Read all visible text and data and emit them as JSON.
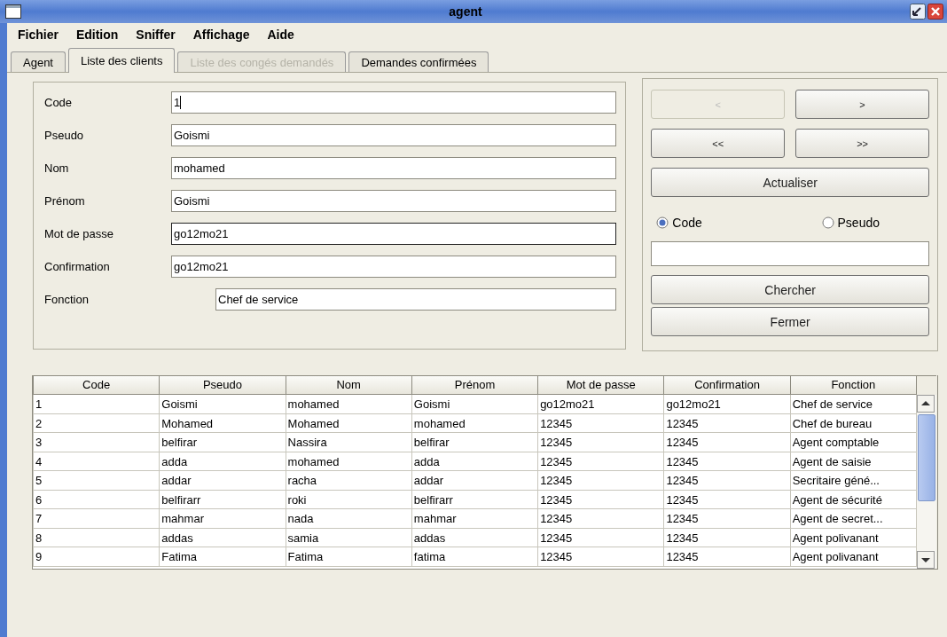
{
  "window": {
    "title": "agent"
  },
  "menu": [
    "Fichier",
    "Edition",
    "Sniffer",
    "Affichage",
    "Aide"
  ],
  "tabs": [
    {
      "label": "Agent",
      "selected": false,
      "disabled": false
    },
    {
      "label": "Liste des clients",
      "selected": true,
      "disabled": false
    },
    {
      "label": "Liste des congés demandés",
      "selected": false,
      "disabled": true
    },
    {
      "label": "Demandes confirmées",
      "selected": false,
      "disabled": false
    }
  ],
  "form": {
    "fields": [
      {
        "label": "Code",
        "value": "1",
        "focused": true,
        "indent": false,
        "highlighted": false
      },
      {
        "label": "Pseudo",
        "value": "Goismi",
        "focused": false,
        "indent": false,
        "highlighted": false
      },
      {
        "label": "Nom",
        "value": "mohamed",
        "focused": false,
        "indent": false,
        "highlighted": false
      },
      {
        "label": "Prénom",
        "value": "Goismi",
        "focused": false,
        "indent": false,
        "highlighted": false
      },
      {
        "label": "Mot de passe",
        "value": "go12mo21",
        "focused": false,
        "indent": false,
        "highlighted": true
      },
      {
        "label": "Confirmation",
        "value": "go12mo21",
        "focused": false,
        "indent": false,
        "highlighted": false
      },
      {
        "label": "Fonction",
        "value": "Chef de service",
        "focused": false,
        "indent": true,
        "highlighted": false
      }
    ]
  },
  "navigation": [
    {
      "label": "<",
      "disabled": true
    },
    {
      "label": ">",
      "disabled": false
    },
    {
      "label": "<<",
      "disabled": false
    },
    {
      "label": ">>",
      "disabled": false
    }
  ],
  "refresh_button": "Actualiser",
  "search": {
    "options": [
      {
        "label": "Code",
        "selected": true
      },
      {
        "label": "Pseudo",
        "selected": false
      }
    ],
    "buttons": [
      "Chercher",
      "Fermer"
    ]
  },
  "table": {
    "columns": [
      "Code",
      "Pseudo",
      "Nom",
      "Prénom",
      "Mot de passe",
      "Confirmation",
      "Fonction"
    ],
    "rows": [
      [
        "1",
        "Goismi",
        "mohamed",
        "Goismi",
        "go12mo21",
        "go12mo21",
        "Chef de service"
      ],
      [
        "2",
        "Mohamed",
        "Mohamed",
        "mohamed",
        "12345",
        "12345",
        "Chef de bureau"
      ],
      [
        "3",
        "belfirar",
        "Nassira",
        "belfirar",
        "12345",
        "12345",
        "Agent comptable"
      ],
      [
        "4",
        "adda",
        "mohamed",
        "adda",
        "12345",
        "12345",
        "Agent de saisie"
      ],
      [
        "5",
        "addar",
        "racha",
        "addar",
        "12345",
        "12345",
        "Secritaire géné..."
      ],
      [
        "6",
        "belfirarr",
        "roki",
        "belfirarr",
        "12345",
        "12345",
        "Agent de sécurité"
      ],
      [
        "7",
        "mahmar",
        "nada",
        "mahmar",
        "12345",
        "12345",
        "Agent de secret..."
      ],
      [
        "8",
        "addas",
        "samia",
        "addas",
        "12345",
        "12345",
        "Agent polivanant"
      ],
      [
        "9",
        "Fatima",
        "Fatima",
        "fatima",
        "12345",
        "12345",
        "Agent polivanant"
      ]
    ]
  }
}
